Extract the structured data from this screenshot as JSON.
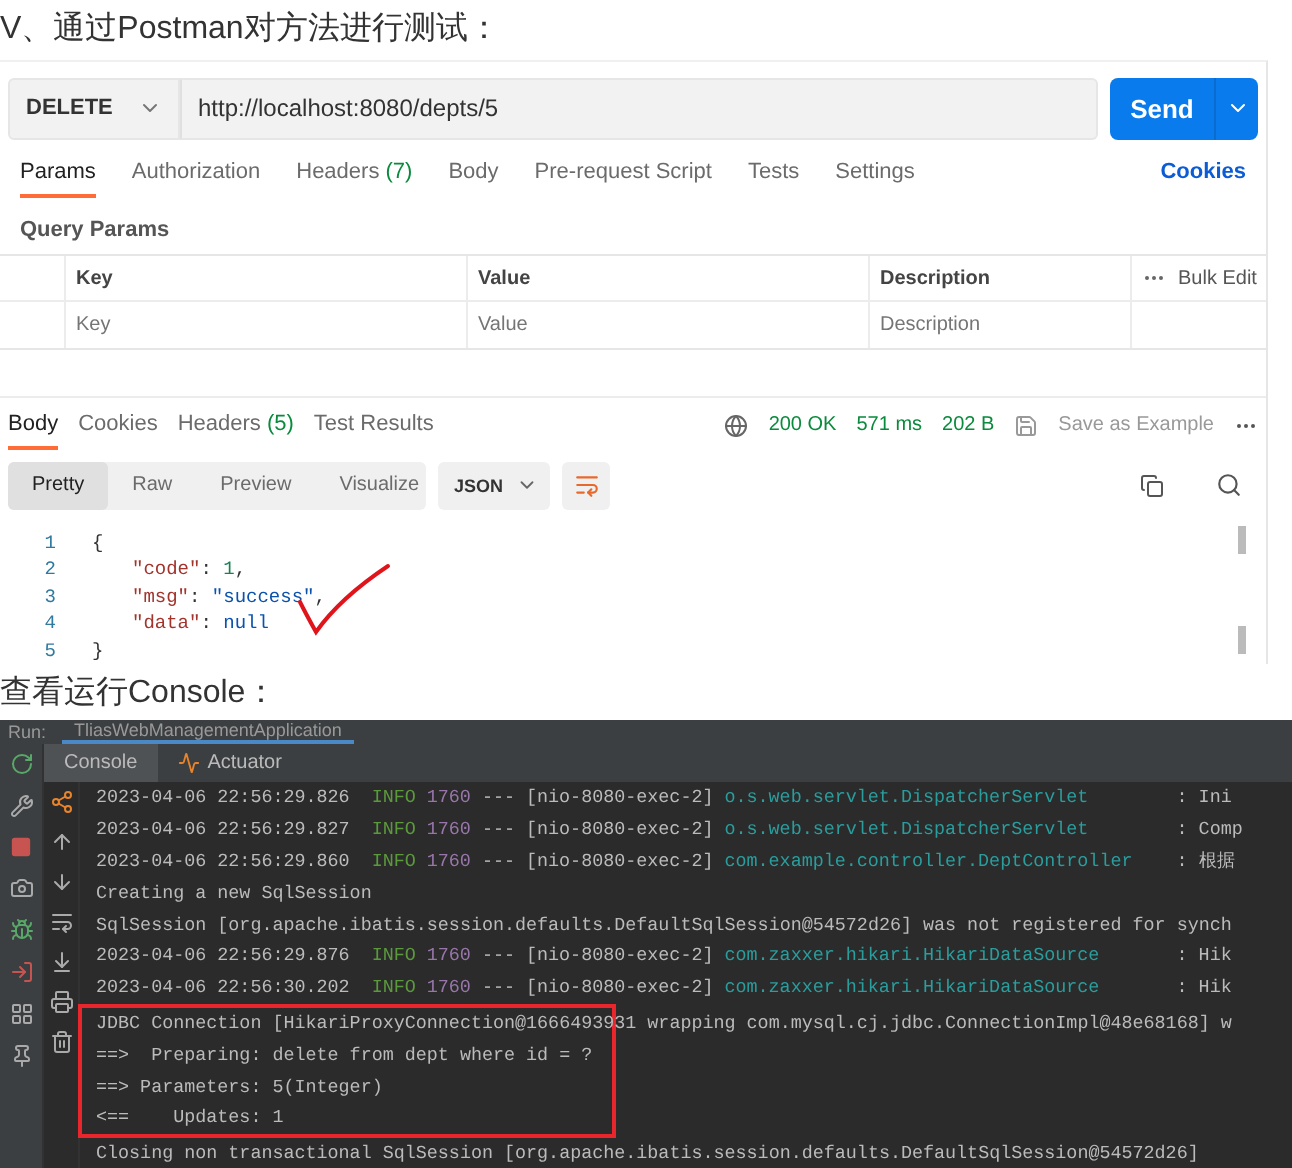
{
  "heading": "V、通过Postman对方法进行测试：",
  "request": {
    "method": "DELETE",
    "url": "http://localhost:8080/depts/5",
    "send": "Send"
  },
  "request_tabs": [
    {
      "label": "Params",
      "selected": true
    },
    {
      "label": "Authorization",
      "selected": false
    },
    {
      "label": "Headers",
      "count": "(7)",
      "selected": false
    },
    {
      "label": "Body",
      "selected": false
    },
    {
      "label": "Pre-request Script",
      "selected": false
    },
    {
      "label": "Tests",
      "selected": false
    },
    {
      "label": "Settings",
      "selected": false
    }
  ],
  "cookies_link": "Cookies",
  "query_params": {
    "title": "Query Params",
    "columns": [
      "Key",
      "Value",
      "Description"
    ],
    "bulk_edit": "Bulk Edit",
    "placeholders": [
      "Key",
      "Value",
      "Description"
    ]
  },
  "response": {
    "tabs": [
      {
        "label": "Body",
        "selected": true
      },
      {
        "label": "Cookies",
        "selected": false
      },
      {
        "label": "Headers",
        "count": "(5)",
        "selected": false
      },
      {
        "label": "Test Results",
        "selected": false
      }
    ],
    "status": "200 OK",
    "time": "571 ms",
    "size": "202 B",
    "save": "Save as Example",
    "views": [
      {
        "label": "Pretty",
        "selected": true
      },
      {
        "label": "Raw",
        "selected": false
      },
      {
        "label": "Preview",
        "selected": false
      },
      {
        "label": "Visualize",
        "selected": false
      }
    ],
    "format": "JSON",
    "lines": [
      {
        "number": "1",
        "indent": false,
        "tokens": [
          {
            "kind": "brace",
            "text": "{"
          }
        ]
      },
      {
        "number": "2",
        "indent": true,
        "tokens": [
          {
            "kind": "key",
            "text": "\"code\""
          },
          {
            "kind": "punct",
            "text": ": "
          },
          {
            "kind": "number",
            "text": "1"
          },
          {
            "kind": "punct",
            "text": ","
          }
        ]
      },
      {
        "number": "3",
        "indent": true,
        "tokens": [
          {
            "kind": "key",
            "text": "\"msg\""
          },
          {
            "kind": "punct",
            "text": ": "
          },
          {
            "kind": "string",
            "text": "\"success\""
          },
          {
            "kind": "punct",
            "text": ","
          }
        ]
      },
      {
        "number": "4",
        "indent": true,
        "tokens": [
          {
            "kind": "key",
            "text": "\"data\""
          },
          {
            "kind": "punct",
            "text": ": "
          },
          {
            "kind": "literal",
            "text": "null"
          }
        ]
      },
      {
        "number": "5",
        "indent": false,
        "tokens": [
          {
            "kind": "brace",
            "text": "}"
          }
        ]
      }
    ]
  },
  "heading_2": "查看运行Console：",
  "ide": {
    "run_label": "Run:",
    "run_tab": "TliasWebManagementApplication",
    "tabs": [
      {
        "label": "Console",
        "selected": true
      },
      {
        "label": "Actuator",
        "selected": false
      }
    ],
    "lines": [
      {
        "kind": "log",
        "boxed": false,
        "time": "2023-04-06 22:56:29.826",
        "level": "INFO",
        "pid": "1760",
        "sep": "---",
        "thread": "[nio-8080-exec-2]",
        "logger": "o.s.web.servlet.DispatcherServlet",
        "message": ": Ini"
      },
      {
        "kind": "log",
        "boxed": false,
        "time": "2023-04-06 22:56:29.827",
        "level": "INFO",
        "pid": "1760",
        "sep": "---",
        "thread": "[nio-8080-exec-2]",
        "logger": "o.s.web.servlet.DispatcherServlet",
        "message": ": Comp"
      },
      {
        "kind": "log",
        "boxed": false,
        "time": "2023-04-06 22:56:29.860",
        "level": "INFO",
        "pid": "1760",
        "sep": "---",
        "thread": "[nio-8080-exec-2]",
        "logger": "com.example.controller.DeptController",
        "message": ": 根据"
      },
      {
        "kind": "plain",
        "boxed": false,
        "text": "Creating a new SqlSession"
      },
      {
        "kind": "plain",
        "boxed": false,
        "text": "SqlSession [org.apache.ibatis.session.defaults.DefaultSqlSession@54572d26] was not registered for synch"
      },
      {
        "kind": "log",
        "boxed": false,
        "time": "2023-04-06 22:56:29.876",
        "level": "INFO",
        "pid": "1760",
        "sep": "---",
        "thread": "[nio-8080-exec-2]",
        "logger": "com.zaxxer.hikari.HikariDataSource",
        "message": ": Hik"
      },
      {
        "kind": "log",
        "boxed": false,
        "time": "2023-04-06 22:56:30.202",
        "level": "INFO",
        "pid": "1760",
        "sep": "---",
        "thread": "[nio-8080-exec-2]",
        "logger": "com.zaxxer.hikari.HikariDataSource",
        "message": ": Hik"
      },
      {
        "kind": "plain",
        "boxed": true,
        "text": "JDBC Connection [HikariProxyConnection@1666493931 wrapping com.mysql.cj.jdbc.ConnectionImpl@48e68168] w"
      },
      {
        "kind": "plain",
        "boxed": true,
        "text": "==>  Preparing: delete from dept where id = ?"
      },
      {
        "kind": "plain",
        "boxed": true,
        "text": "==> Parameters: 5(Integer)"
      },
      {
        "kind": "plain",
        "boxed": true,
        "text": "<==    Updates: 1"
      },
      {
        "kind": "plain",
        "boxed": false,
        "text": "Closing non transactional SqlSession [org.apache.ibatis.session.defaults.DefaultSqlSession@54572d26]"
      }
    ]
  }
}
